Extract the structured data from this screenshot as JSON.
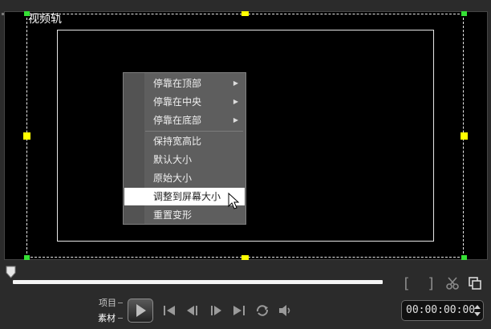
{
  "preview": {
    "track_label": "视频轨"
  },
  "context_menu": {
    "items": [
      {
        "label": "停靠在顶部",
        "submenu": true
      },
      {
        "label": "停靠在中央",
        "submenu": true
      },
      {
        "label": "停靠在底部",
        "submenu": true
      },
      {
        "label": "保持宽高比",
        "submenu": false
      },
      {
        "label": "默认大小",
        "submenu": false
      },
      {
        "label": "原始大小",
        "submenu": false
      },
      {
        "label": "调整到屏幕大小",
        "submenu": false,
        "highlighted": true
      },
      {
        "label": "重置变形",
        "submenu": false
      }
    ],
    "arrow": "▶"
  },
  "mode": {
    "project_label": "项目",
    "clip_label": "素材"
  },
  "controls": {
    "mark_in": "[",
    "mark_out": "]",
    "timecode": "00:00:00:00"
  },
  "colors": {
    "handle_yellow": "#ffff00",
    "handle_green": "#35e035",
    "menu_bg": "#5e5e5e",
    "menu_highlight": "#ffffff"
  },
  "icons": [
    "scissors-icon",
    "copy-icon",
    "play-icon",
    "home-icon",
    "prev-frame-icon",
    "next-frame-icon",
    "end-icon",
    "repeat-icon",
    "volume-icon",
    "cursor-icon"
  ]
}
